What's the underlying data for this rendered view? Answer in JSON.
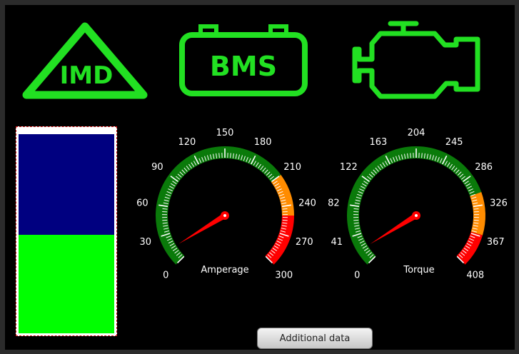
{
  "indicators": {
    "imd_label": "IMD",
    "bms_label": "BMS",
    "engine_icon": "engine-icon",
    "color": "#22e022"
  },
  "level_bar": {
    "fill_fraction": 0.49,
    "fill_color": "#00ff00",
    "empty_color": "#000080"
  },
  "amperage_gauge": {
    "label": "Amperage",
    "min": 0,
    "max": 300,
    "value": 15,
    "tick_labels": [
      "0",
      "30",
      "60",
      "90",
      "120",
      "150",
      "180",
      "210",
      "240",
      "270",
      "300"
    ],
    "zones": [
      {
        "from": 0,
        "to": 210,
        "color": "#0a7a0a"
      },
      {
        "from": 210,
        "to": 250,
        "color": "#ff8c00"
      },
      {
        "from": 250,
        "to": 300,
        "color": "#ff0000"
      }
    ],
    "needle_color": "#ff0000"
  },
  "torque_gauge": {
    "label": "Torque",
    "min": 0,
    "max": 408,
    "value": 20,
    "tick_labels": [
      "0",
      "41",
      "82",
      "122",
      "163",
      "204",
      "245",
      "286",
      "326",
      "367",
      "408"
    ],
    "zones": [
      {
        "from": 0,
        "to": 310,
        "color": "#0a7a0a"
      },
      {
        "from": 310,
        "to": 365,
        "color": "#ff8c00"
      },
      {
        "from": 365,
        "to": 408,
        "color": "#ff0000"
      }
    ],
    "needle_color": "#ff0000"
  },
  "buttons": {
    "additional_data": "Additional data"
  }
}
